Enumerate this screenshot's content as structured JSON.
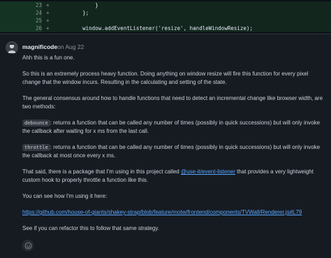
{
  "diff": {
    "lines": [
      {
        "num": "23",
        "sign": "+",
        "code": "            }"
      },
      {
        "num": "24",
        "sign": "+",
        "code": "        };"
      },
      {
        "num": "25",
        "sign": "+",
        "code": ""
      },
      {
        "num": "26",
        "sign": "+",
        "code": "        window.addEventListener('resize', handleWindowResize);"
      }
    ]
  },
  "comment": {
    "author": "magnificode",
    "date": "on Aug 22",
    "p1": "Ahh this is a fun one.",
    "p2": "So this is an extremely process heavy function. Doing anything on window resize will fire this function for every pixel change that the window incurs. Resulting in the calculating and setting of the state.",
    "p3": "The general consensus around how to handle functions that need to detect an incremental change like browser width, are two methods:",
    "debounce_code": "debounce",
    "debounce_text": ": returns a function that can be called any number of times (possibly in quick successions) but will only invoke the callback after waiting for x ms from the last call.",
    "throttle_code": "throttle",
    "throttle_text": ": returns a function that can be called any number of times (possibly in quick successions) but will only invoke the callback at most once every x ms.",
    "p4_before": "That said, there is a package that I'm using in this project called ",
    "p4_link": "@use-it/event-listener",
    "p4_after": " that provides a very lightweight custom hook to properly throttle a function like this.",
    "p5": "You can see how I'm using it here:",
    "link": "https://github.com/house-of-giants/shakey-strap/blob/feature/motw/frontend/components/TVWall/Renderer.js#L79",
    "p6": "See if you can refactor this to follow that same strategy."
  },
  "icons": {
    "avatar": "user-avatar",
    "reaction": "smiley-icon"
  },
  "colors": {
    "background": "#0d1117",
    "comment_bg": "#161b22",
    "diff_added": "#12261e",
    "link": "#58a6ff",
    "text": "#c9d1d9"
  }
}
